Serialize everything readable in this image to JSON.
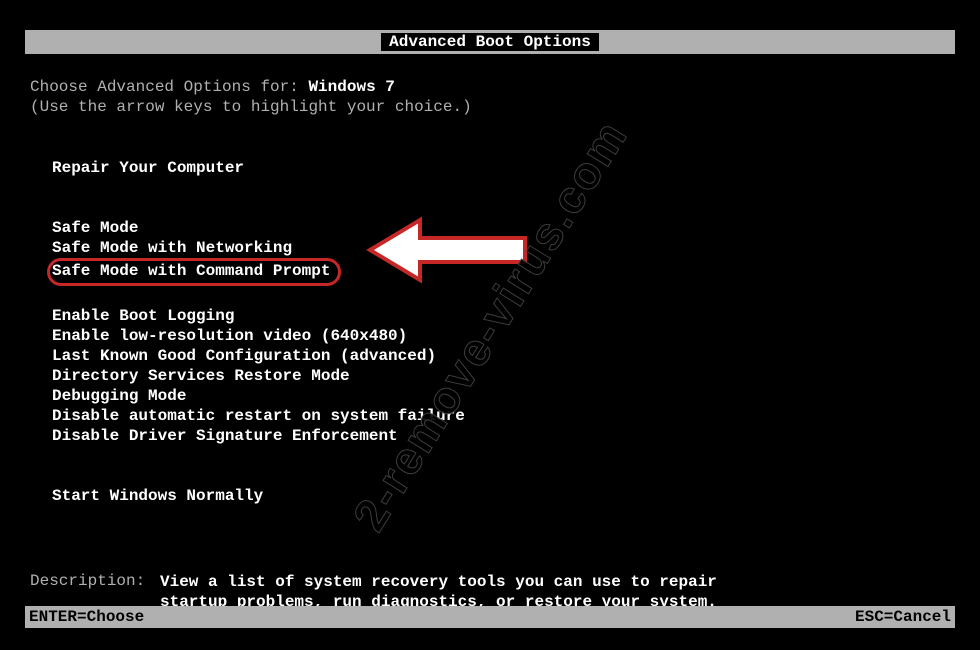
{
  "title": "Advanced Boot Options",
  "header": {
    "prefix": "Choose Advanced Options for: ",
    "os": "Windows 7",
    "hint": "(Use the arrow keys to highlight your choice.)"
  },
  "menu": {
    "group1": [
      "Repair Your Computer"
    ],
    "group2": [
      "Safe Mode",
      "Safe Mode with Networking",
      "Safe Mode with Command Prompt"
    ],
    "group3": [
      "Enable Boot Logging",
      "Enable low-resolution video (640x480)",
      "Last Known Good Configuration (advanced)",
      "Directory Services Restore Mode",
      "Debugging Mode",
      "Disable automatic restart on system failure",
      "Disable Driver Signature Enforcement"
    ],
    "group4": [
      "Start Windows Normally"
    ],
    "highlighted_index": 2
  },
  "description": {
    "label": "Description:",
    "text_line1": "View a list of system recovery tools you can use to repair",
    "text_line2": "startup problems, run diagnostics, or restore your system."
  },
  "footer": {
    "left": "ENTER=Choose",
    "right": "ESC=Cancel"
  },
  "watermark": "2-remove-virus.com"
}
